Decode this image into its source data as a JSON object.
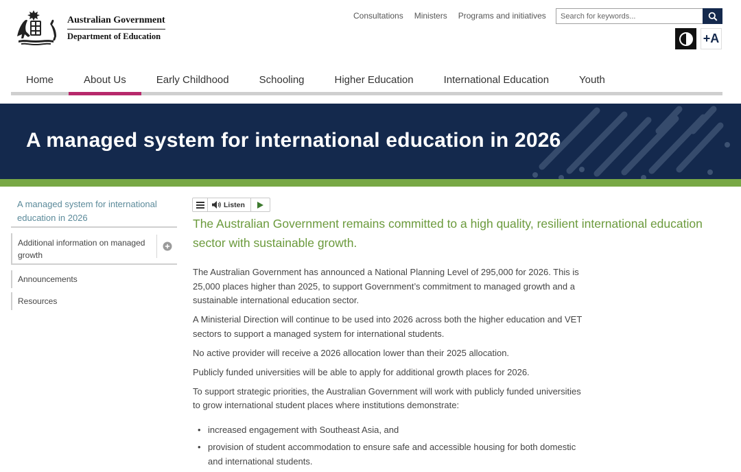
{
  "header": {
    "logo_line1": "Australian Government",
    "logo_line2": "Department of Education",
    "utility_links": [
      "Consultations",
      "Ministers",
      "Programs and initiatives"
    ],
    "search_placeholder": "Search for keywords...",
    "font_size_label": "+A"
  },
  "nav": {
    "items": [
      "Home",
      "About Us",
      "Early Childhood",
      "Schooling",
      "Higher Education",
      "International Education",
      "Youth"
    ],
    "active": "About Us"
  },
  "banner": {
    "title": "A managed system for international education in 2026"
  },
  "sidebar": {
    "current": "A managed system for international education in 2026",
    "sub_item": "Additional information on managed growth",
    "items": [
      "Announcements",
      "Resources"
    ]
  },
  "listen": {
    "label": "Listen"
  },
  "main": {
    "lead": "The Australian Government remains committed to a high quality, resilient international education sector with sustainable growth.",
    "paragraphs": [
      "The Australian Government has announced a National Planning Level of 295,000 for 2026. This is 25,000 places higher than 2025, to support Government’s commitment to managed growth and a sustainable international education sector.",
      "A Ministerial Direction will continue to be used into 2026 across both the higher education and VET sectors to support a managed system for international students.",
      "No active provider will receive a 2026 allocation lower than their 2025 allocation.",
      "Publicly funded universities will be able to apply for additional growth places for 2026.",
      "To support strategic priorities, the Australian Government will work with publicly funded universities to grow international student places where institutions demonstrate:"
    ],
    "bullets": [
      "increased engagement with Southeast Asia, and",
      "provision of student accommodation to ensure safe and accessible housing for both domestic and international students."
    ]
  },
  "colors": {
    "navy": "#14294d",
    "accent_pink": "#b7296b",
    "green": "#78a845",
    "lead_green": "#6b9a3c",
    "link_teal": "#5b8a9a"
  },
  "icons": [
    "coat-of-arms-crest",
    "search-icon",
    "contrast-icon",
    "hamburger-icon",
    "speaker-icon",
    "play-icon",
    "plus-circle-icon"
  ]
}
